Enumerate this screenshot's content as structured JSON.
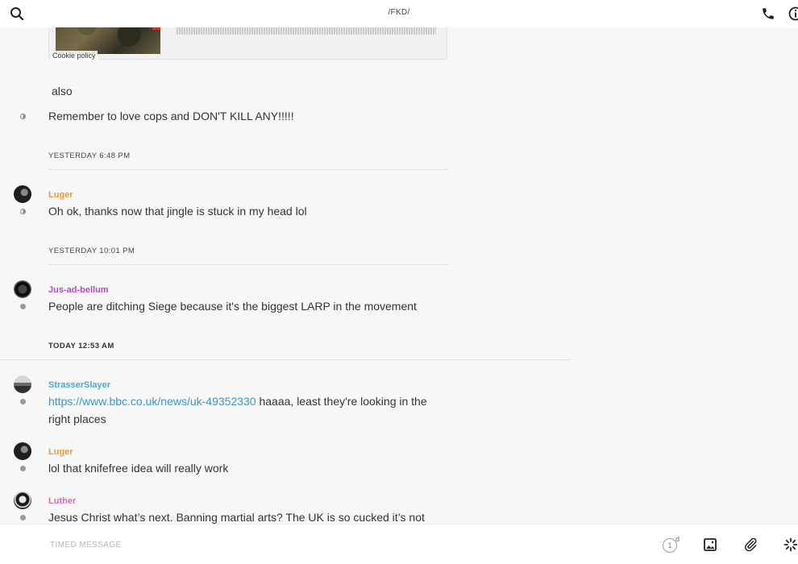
{
  "header": {
    "title": "/FKD/"
  },
  "media": {
    "cookie_label": "Cookie policy"
  },
  "messages": [
    {
      "text": "also"
    },
    {
      "text": "Remember to love cops and DON'T KILL ANY!!!!!"
    }
  ],
  "dates": {
    "d1": "YESTERDAY 6:48 PM",
    "d2": "YESTERDAY 10:01 PM",
    "d3": "TODAY 12:53 AM"
  },
  "posts": [
    {
      "user": "Luger",
      "text": "Oh ok, thanks now that jingle is stuck in my head lol"
    },
    {
      "user": "Jus-ad-bellum",
      "text": "People are ditching Siege because it's the biggest LARP in the movement"
    },
    {
      "user": "StrasserSlayer",
      "link": "https://www.bbc.co.uk/news/uk-49352330",
      "text": " haaaa, least they're looking in the right places"
    },
    {
      "user": "Luger",
      "text": "lol that knifefree idea will really work"
    },
    {
      "user": "Luther",
      "text": "Jesus Christ what’s next. Banning martial arts? The UK is so cucked it’s not"
    }
  ],
  "composer": {
    "placeholder": "TIMED MESSAGE",
    "timer_value": "1",
    "timer_unit": "d"
  },
  "colors": {
    "luger": "#e79a3c",
    "jus": "#b04bc9",
    "strasser": "#4aa8d2",
    "luther": "#d36ab6",
    "link": "#3d95c9"
  }
}
